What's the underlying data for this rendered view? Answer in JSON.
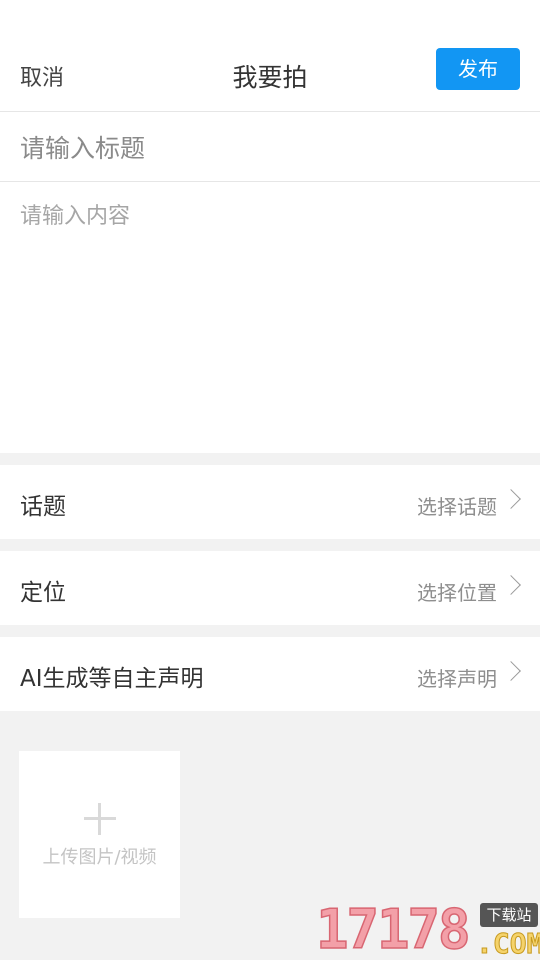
{
  "header": {
    "cancel_label": "取消",
    "title": "我要拍",
    "publish_label": "发布"
  },
  "form": {
    "title_placeholder": "请输入标题",
    "title_value": "",
    "content_placeholder": "请输入内容",
    "content_value": ""
  },
  "rows": [
    {
      "label": "话题",
      "value": "选择话题",
      "icon": "chevron-right-icon"
    },
    {
      "label": "定位",
      "value": "选择位置",
      "icon": "chevron-right-icon"
    },
    {
      "label": "AI生成等自主声明",
      "value": "选择声明",
      "icon": "chevron-right-icon"
    }
  ],
  "upload": {
    "label": "上传图片/视频",
    "icon": "plus-icon"
  },
  "watermark": {
    "number": "17178",
    "badge": "下载站",
    "suffix": ".COM"
  },
  "colors": {
    "accent": "#1296f3",
    "background": "#f2f2f2",
    "placeholder": "#a6a6a6"
  }
}
